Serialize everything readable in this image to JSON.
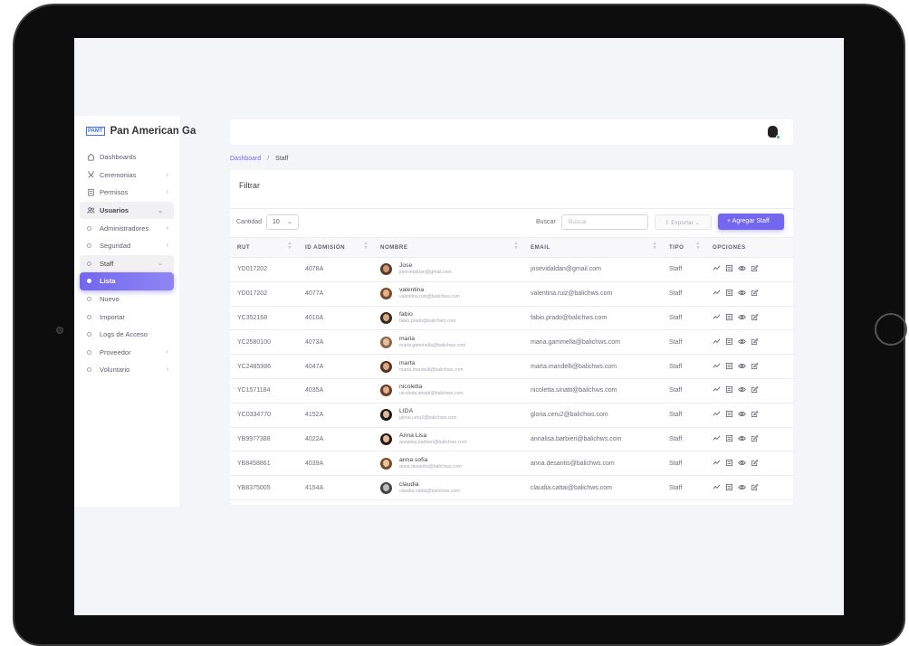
{
  "brand": {
    "logo": "PAMT",
    "name": "Pan American Ga"
  },
  "sidebar": {
    "items": [
      {
        "label": "Dashboards",
        "icon": "home-icon",
        "chevron": ""
      },
      {
        "label": "Ceremonias",
        "icon": "ceremony-icon",
        "chevron": "›"
      },
      {
        "label": "Permisos",
        "icon": "clipboard-icon",
        "chevron": "›"
      },
      {
        "label": "Usuarios",
        "icon": "users-icon",
        "chevron": "⌄"
      }
    ],
    "usuarios_sub": [
      {
        "label": "Administradores",
        "chevron": "›"
      },
      {
        "label": "Seguridad",
        "chevron": "›"
      },
      {
        "label": "Staff",
        "chevron": "⌄"
      }
    ],
    "staff_sub": [
      {
        "label": "Lista"
      },
      {
        "label": "Nuevo"
      },
      {
        "label": "Importar"
      },
      {
        "label": "Logs de Acceso"
      }
    ],
    "after": [
      {
        "label": "Proveedor",
        "chevron": "›"
      },
      {
        "label": "Voluntario",
        "chevron": "›"
      }
    ]
  },
  "breadcrumb": {
    "link": "Dashboard",
    "sep": "/",
    "current": "Staff"
  },
  "card": {
    "title": "Filtrar",
    "cantidad_label": "Cantidad",
    "cantidad_value": "10",
    "buscar_label": "Buscar",
    "buscar_placeholder": "Buscar",
    "export_label": "Exportar",
    "add_label": "+ Agregar Staff"
  },
  "table": {
    "headers": [
      "RUT",
      "ID ADMISIÓN",
      "NOMBRE",
      "EMAIL",
      "TIPO",
      "OPCIONES"
    ],
    "rows": [
      {
        "rut": "YD017202",
        "id": "4078A",
        "name": "Jose",
        "sub": "josevidaldan@gmail.com",
        "email": "josevidaldan@gmail.com",
        "tipo": "Staff",
        "hair": "#5a3a2a",
        "skin": "#c99a78"
      },
      {
        "rut": "YD017202",
        "id": "4077A",
        "name": "valentina",
        "sub": "valentina.ruiz@balichws.com",
        "email": "valentina.ruiz@balichws.com",
        "tipo": "Staff",
        "hair": "#7a4a2a",
        "skin": "#e2b28c"
      },
      {
        "rut": "YC352168",
        "id": "4010A",
        "name": "fabio",
        "sub": "fabio.prado@balichws.com",
        "email": "fabio.prado@balichws.com",
        "tipo": "Staff",
        "hair": "#3a2a22",
        "skin": "#d6a884"
      },
      {
        "rut": "YC2580100",
        "id": "4073A",
        "name": "maria",
        "sub": "maria.gammella@balichws.com",
        "email": "maria.gammella@balichws.com",
        "tipo": "Staff",
        "hair": "#8a6a4a",
        "skin": "#e6c0a0"
      },
      {
        "rut": "YC2485986",
        "id": "4047A",
        "name": "marta",
        "sub": "marta.mandelli@balichws.com",
        "email": "marta.mandelli@balichws.com",
        "tipo": "Staff",
        "hair": "#5a3220",
        "skin": "#d8a888"
      },
      {
        "rut": "YC1571184",
        "id": "4035A",
        "name": "nicoletta",
        "sub": "nicoletta.sinatti@balichws.com",
        "email": "nicoletta.sinatti@balichws.com",
        "tipo": "Staff",
        "hair": "#6a3a2a",
        "skin": "#dcae8c"
      },
      {
        "rut": "YC0334770",
        "id": "4152A",
        "name": "LIDA",
        "sub": "gloria.ceru2@balichws.com",
        "email": "gloria.ceru2@balichws.com",
        "tipo": "Staff",
        "hair": "#1a1a1a",
        "skin": "#e0b898"
      },
      {
        "rut": "YB9977388",
        "id": "4022A",
        "name": "Anna Lisa",
        "sub": "annalisa.barbieri@balichws.com",
        "email": "annalisa.barbieri@balichws.com",
        "tipo": "Staff",
        "hair": "#2a1a14",
        "skin": "#e4bca0"
      },
      {
        "rut": "YB8458861",
        "id": "4039A",
        "name": "anna sofia",
        "sub": "anna.desantis@balichws.com",
        "email": "anna.desantis@balichws.com",
        "tipo": "Staff",
        "hair": "#7a4a26",
        "skin": "#e8c4a2"
      },
      {
        "rut": "YB8375005",
        "id": "4154A",
        "name": "claudia",
        "sub": "claudia.cattai@balichws.com",
        "email": "claudia.cattai@balichws.com",
        "tipo": "Staff",
        "hair": "#444444",
        "skin": "#bbbbbb"
      }
    ]
  },
  "colors": {
    "accent": "#7367f0",
    "online": "#28c76f"
  }
}
